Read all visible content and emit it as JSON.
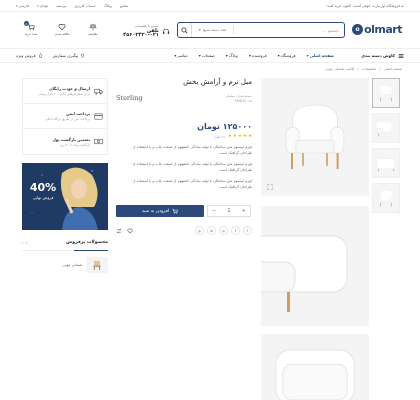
{
  "topbar": {
    "welcome": "به فروشگاه اول‌مارت خوش آمدید. اکنون خرید کنید!",
    "links": [
      "تماس",
      "وبلاگ",
      "حساب کاربری",
      "بپرسید"
    ],
    "currency": "تومان",
    "language": "فارسی"
  },
  "header": {
    "logo_text": "olmart",
    "logo_mark": "o",
    "search_placeholder": "جستجو ...",
    "search_category": "همه دسته بندیها",
    "phone_label": "تماس با پشتیبانی",
    "phone_number": "تلفن ۰۲۱-۴۵۶۰۳۴۳۰",
    "icons": [
      {
        "label": "مقایسه",
        "icon": "compare-icon"
      },
      {
        "label": "علاقه مندی",
        "icon": "heart-icon"
      },
      {
        "label": "سبد خرید",
        "icon": "cart-icon",
        "count": "0"
      }
    ]
  },
  "nav": {
    "categories_label": "کاوش دسته بندی",
    "menu": [
      {
        "label": "صفحه اصلی",
        "active": true
      },
      {
        "label": "فروشگاه",
        "active": false
      },
      {
        "label": "فروشنده",
        "active": false
      },
      {
        "label": "وبلاگ",
        "active": false
      },
      {
        "label": "صفحات",
        "active": false
      },
      {
        "label": "عناصر",
        "active": false
      }
    ],
    "track_order": "پیگیری سفارش",
    "special_sale": "فروش ویژه"
  },
  "breadcrumb": [
    "صفحه اصلی",
    "محصولات",
    "کاناپه، صندلی چوبی"
  ],
  "product": {
    "title": "مبل نرم و آرامش بخش",
    "brand": "Sterling",
    "meta_lines": [
      "دسته بندی: مبلمان",
      "کد: M0810"
    ],
    "price": "۱۲۵۰۰۰ تومان",
    "rating": 5,
    "review_count": "(۲ نظر)",
    "description": [
      "لورم ایپسوم متن ساختگی با تولید سادگی نامفهوم از صنعت چاپ و با استفاده از طراحان گرافیک است.",
      "لورم ایپسوم متن ساختگی با تولید سادگی نامفهوم از صنعت چاپ و با استفاده از طراحان گرافیک است.",
      "لورم ایپسوم متن ساختگی با تولید سادگی نامفهوم از صنعت چاپ و با استفاده از طراحان گرافیک است."
    ],
    "quantity": "1",
    "add_to_cart": "افزودن به سبد",
    "social": [
      "f",
      "t",
      "p",
      "in",
      "g"
    ]
  },
  "features": [
    {
      "title": "ارسال و عودت رایگان",
      "subtitle": "برای سفارش‌های بالای ۲۰۰ هزار تومان",
      "icon": "truck-icon"
    },
    {
      "title": "پرداخت ایمن",
      "subtitle": "پرداخت امن از طریق درگاه بانکی",
      "icon": "card-icon"
    },
    {
      "title": "تضمین بازگشت پول",
      "subtitle": "بازگشت وجه تا ۳۰ روز",
      "icon": "money-icon"
    }
  ],
  "banner": {
    "percent": "40%",
    "label": "فروش نهایی"
  },
  "bestsellers": {
    "title": "محصولات پرفروش",
    "items": [
      {
        "name": "صندلی چوبی"
      }
    ]
  },
  "colors": {
    "primary": "#2b4a7b",
    "star": "#f5b301"
  }
}
